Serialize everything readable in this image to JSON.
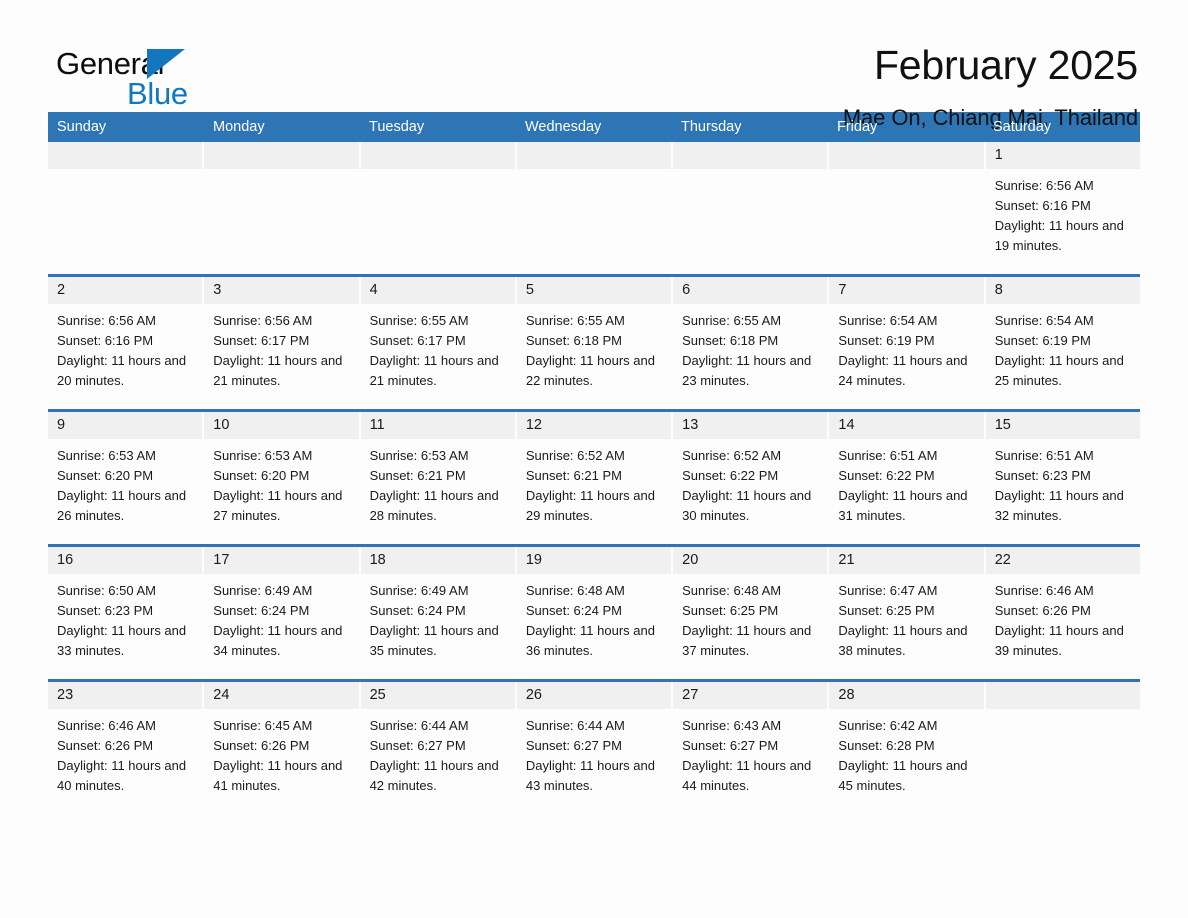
{
  "brand": {
    "name_part1": "General",
    "name_part2": "Blue",
    "accent_color": "#1277bf"
  },
  "header": {
    "title": "February 2025",
    "subtitle": "Mae On, Chiang Mai, Thailand",
    "header_bar_color": "#2e75b6"
  },
  "weekdays": [
    "Sunday",
    "Monday",
    "Tuesday",
    "Wednesday",
    "Thursday",
    "Friday",
    "Saturday"
  ],
  "weeks": [
    [
      {
        "day": "",
        "sunrise": "",
        "sunset": "",
        "daylight": "",
        "empty": true
      },
      {
        "day": "",
        "sunrise": "",
        "sunset": "",
        "daylight": "",
        "empty": true
      },
      {
        "day": "",
        "sunrise": "",
        "sunset": "",
        "daylight": "",
        "empty": true
      },
      {
        "day": "",
        "sunrise": "",
        "sunset": "",
        "daylight": "",
        "empty": true
      },
      {
        "day": "",
        "sunrise": "",
        "sunset": "",
        "daylight": "",
        "empty": true
      },
      {
        "day": "",
        "sunrise": "",
        "sunset": "",
        "daylight": "",
        "empty": true
      },
      {
        "day": "1",
        "sunrise": "Sunrise: 6:56 AM",
        "sunset": "Sunset: 6:16 PM",
        "daylight": "Daylight: 11 hours and 19 minutes.",
        "empty": false
      }
    ],
    [
      {
        "day": "2",
        "sunrise": "Sunrise: 6:56 AM",
        "sunset": "Sunset: 6:16 PM",
        "daylight": "Daylight: 11 hours and 20 minutes.",
        "empty": false
      },
      {
        "day": "3",
        "sunrise": "Sunrise: 6:56 AM",
        "sunset": "Sunset: 6:17 PM",
        "daylight": "Daylight: 11 hours and 21 minutes.",
        "empty": false
      },
      {
        "day": "4",
        "sunrise": "Sunrise: 6:55 AM",
        "sunset": "Sunset: 6:17 PM",
        "daylight": "Daylight: 11 hours and 21 minutes.",
        "empty": false
      },
      {
        "day": "5",
        "sunrise": "Sunrise: 6:55 AM",
        "sunset": "Sunset: 6:18 PM",
        "daylight": "Daylight: 11 hours and 22 minutes.",
        "empty": false
      },
      {
        "day": "6",
        "sunrise": "Sunrise: 6:55 AM",
        "sunset": "Sunset: 6:18 PM",
        "daylight": "Daylight: 11 hours and 23 minutes.",
        "empty": false
      },
      {
        "day": "7",
        "sunrise": "Sunrise: 6:54 AM",
        "sunset": "Sunset: 6:19 PM",
        "daylight": "Daylight: 11 hours and 24 minutes.",
        "empty": false
      },
      {
        "day": "8",
        "sunrise": "Sunrise: 6:54 AM",
        "sunset": "Sunset: 6:19 PM",
        "daylight": "Daylight: 11 hours and 25 minutes.",
        "empty": false
      }
    ],
    [
      {
        "day": "9",
        "sunrise": "Sunrise: 6:53 AM",
        "sunset": "Sunset: 6:20 PM",
        "daylight": "Daylight: 11 hours and 26 minutes.",
        "empty": false
      },
      {
        "day": "10",
        "sunrise": "Sunrise: 6:53 AM",
        "sunset": "Sunset: 6:20 PM",
        "daylight": "Daylight: 11 hours and 27 minutes.",
        "empty": false
      },
      {
        "day": "11",
        "sunrise": "Sunrise: 6:53 AM",
        "sunset": "Sunset: 6:21 PM",
        "daylight": "Daylight: 11 hours and 28 minutes.",
        "empty": false
      },
      {
        "day": "12",
        "sunrise": "Sunrise: 6:52 AM",
        "sunset": "Sunset: 6:21 PM",
        "daylight": "Daylight: 11 hours and 29 minutes.",
        "empty": false
      },
      {
        "day": "13",
        "sunrise": "Sunrise: 6:52 AM",
        "sunset": "Sunset: 6:22 PM",
        "daylight": "Daylight: 11 hours and 30 minutes.",
        "empty": false
      },
      {
        "day": "14",
        "sunrise": "Sunrise: 6:51 AM",
        "sunset": "Sunset: 6:22 PM",
        "daylight": "Daylight: 11 hours and 31 minutes.",
        "empty": false
      },
      {
        "day": "15",
        "sunrise": "Sunrise: 6:51 AM",
        "sunset": "Sunset: 6:23 PM",
        "daylight": "Daylight: 11 hours and 32 minutes.",
        "empty": false
      }
    ],
    [
      {
        "day": "16",
        "sunrise": "Sunrise: 6:50 AM",
        "sunset": "Sunset: 6:23 PM",
        "daylight": "Daylight: 11 hours and 33 minutes.",
        "empty": false
      },
      {
        "day": "17",
        "sunrise": "Sunrise: 6:49 AM",
        "sunset": "Sunset: 6:24 PM",
        "daylight": "Daylight: 11 hours and 34 minutes.",
        "empty": false
      },
      {
        "day": "18",
        "sunrise": "Sunrise: 6:49 AM",
        "sunset": "Sunset: 6:24 PM",
        "daylight": "Daylight: 11 hours and 35 minutes.",
        "empty": false
      },
      {
        "day": "19",
        "sunrise": "Sunrise: 6:48 AM",
        "sunset": "Sunset: 6:24 PM",
        "daylight": "Daylight: 11 hours and 36 minutes.",
        "empty": false
      },
      {
        "day": "20",
        "sunrise": "Sunrise: 6:48 AM",
        "sunset": "Sunset: 6:25 PM",
        "daylight": "Daylight: 11 hours and 37 minutes.",
        "empty": false
      },
      {
        "day": "21",
        "sunrise": "Sunrise: 6:47 AM",
        "sunset": "Sunset: 6:25 PM",
        "daylight": "Daylight: 11 hours and 38 minutes.",
        "empty": false
      },
      {
        "day": "22",
        "sunrise": "Sunrise: 6:46 AM",
        "sunset": "Sunset: 6:26 PM",
        "daylight": "Daylight: 11 hours and 39 minutes.",
        "empty": false
      }
    ],
    [
      {
        "day": "23",
        "sunrise": "Sunrise: 6:46 AM",
        "sunset": "Sunset: 6:26 PM",
        "daylight": "Daylight: 11 hours and 40 minutes.",
        "empty": false
      },
      {
        "day": "24",
        "sunrise": "Sunrise: 6:45 AM",
        "sunset": "Sunset: 6:26 PM",
        "daylight": "Daylight: 11 hours and 41 minutes.",
        "empty": false
      },
      {
        "day": "25",
        "sunrise": "Sunrise: 6:44 AM",
        "sunset": "Sunset: 6:27 PM",
        "daylight": "Daylight: 11 hours and 42 minutes.",
        "empty": false
      },
      {
        "day": "26",
        "sunrise": "Sunrise: 6:44 AM",
        "sunset": "Sunset: 6:27 PM",
        "daylight": "Daylight: 11 hours and 43 minutes.",
        "empty": false
      },
      {
        "day": "27",
        "sunrise": "Sunrise: 6:43 AM",
        "sunset": "Sunset: 6:27 PM",
        "daylight": "Daylight: 11 hours and 44 minutes.",
        "empty": false
      },
      {
        "day": "28",
        "sunrise": "Sunrise: 6:42 AM",
        "sunset": "Sunset: 6:28 PM",
        "daylight": "Daylight: 11 hours and 45 minutes.",
        "empty": false
      },
      {
        "day": "",
        "sunrise": "",
        "sunset": "",
        "daylight": "",
        "empty": true
      }
    ]
  ]
}
